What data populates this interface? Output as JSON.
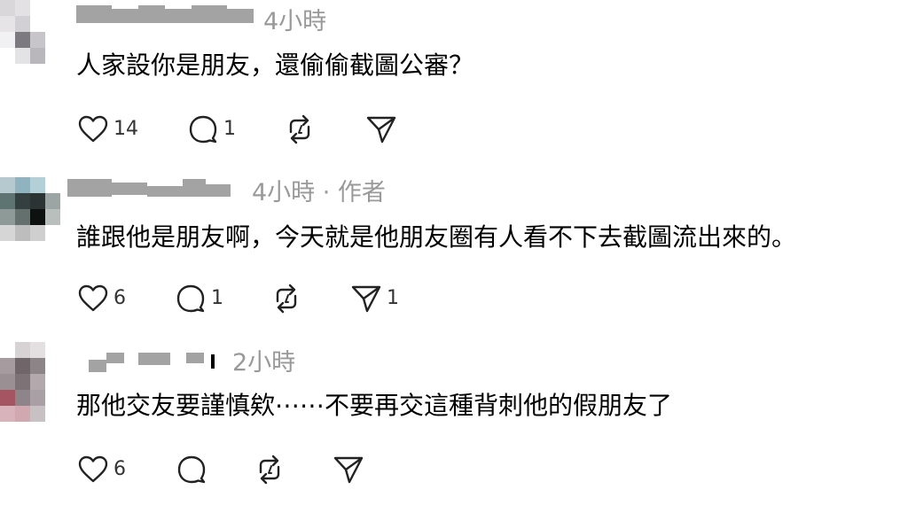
{
  "comments": [
    {
      "time": "4小時",
      "meta_extra": "",
      "text": "人家設你是朋友，還偷偷截圖公審？",
      "likes": "14",
      "replies": "1",
      "reposts": "",
      "shares": ""
    },
    {
      "time": "4小時",
      "meta_extra": " · 作者",
      "text": "誰跟他是朋友啊，今天就是他朋友圈有人看不下去截圖流出來的。",
      "likes": "6",
      "replies": "1",
      "reposts": "",
      "shares": "1"
    },
    {
      "time": "2小時",
      "meta_extra": "",
      "text": "那他交友要謹慎欸⋯⋯不要再交這種背刺他的假朋友了",
      "likes": "6",
      "replies": "",
      "reposts": "",
      "shares": ""
    }
  ],
  "icons": {
    "like": "heart-icon",
    "reply": "comment-bubble-icon",
    "repost": "repost-icon",
    "share": "send-icon"
  },
  "colors": {
    "text": "#000000",
    "meta": "#999999",
    "icon": "#222222",
    "redacted": "#a3a3a3"
  }
}
